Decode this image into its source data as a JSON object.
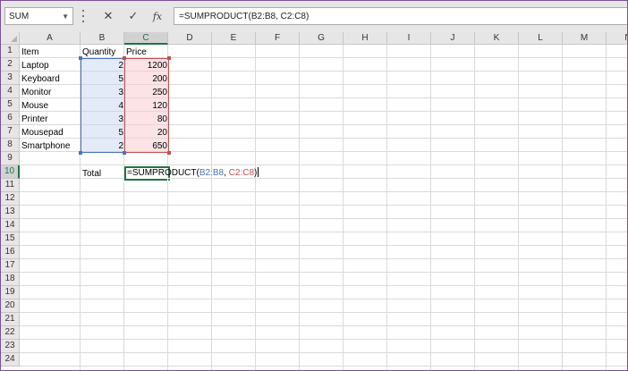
{
  "formula_bar": {
    "name_box": "SUM",
    "cancel_icon": "close-icon",
    "enter_icon": "check-icon",
    "fx_label": "fx",
    "formula": "=SUMPRODUCT(B2:B8, C2:C8)"
  },
  "columns": [
    "A",
    "B",
    "C",
    "D",
    "E",
    "F",
    "G",
    "H",
    "I",
    "J",
    "K",
    "L",
    "M",
    "N"
  ],
  "rows": [
    "1",
    "2",
    "3",
    "4",
    "5",
    "6",
    "7",
    "8",
    "9",
    "10",
    "11",
    "12",
    "13",
    "14",
    "15",
    "16",
    "17",
    "18",
    "19",
    "20",
    "21",
    "22",
    "23",
    "24"
  ],
  "selection": {
    "active_cell": "C10",
    "ranges": [
      "B2:B8",
      "C2:C8"
    ],
    "colors": {
      "b_range": "#4a74b8",
      "c_range": "#c0504d",
      "active": "#217346"
    }
  },
  "sheet": {
    "headers": {
      "item": "Item",
      "quantity": "Quantity",
      "price": "Price"
    },
    "items": [
      {
        "name": "Laptop",
        "quantity": "2",
        "price": "1200"
      },
      {
        "name": "Keyboard",
        "quantity": "5",
        "price": "200"
      },
      {
        "name": "Monitor",
        "quantity": "3",
        "price": "250"
      },
      {
        "name": "Mouse",
        "quantity": "4",
        "price": "120"
      },
      {
        "name": "Printer",
        "quantity": "3",
        "price": "80"
      },
      {
        "name": "Mousepad",
        "quantity": "5",
        "price": "20"
      },
      {
        "name": "Smartphone",
        "quantity": "2",
        "price": "650"
      }
    ],
    "total_label": "Total",
    "total_formula": {
      "prefix": "=SUMPRODUCT(",
      "ref_b": "B2:B8",
      "separator": ", ",
      "ref_c": "C2:C8",
      "suffix": ")"
    }
  }
}
